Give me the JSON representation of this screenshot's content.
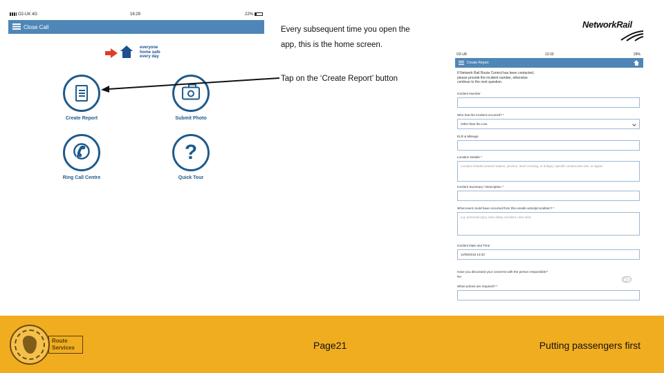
{
  "phone_left": {
    "status": {
      "carrier": "O2-UK 4G",
      "time": "16:29",
      "battery": "22%"
    },
    "title": "Close Call",
    "slogan": [
      "everyone",
      "home safe",
      "every day"
    ],
    "tiles": [
      {
        "label": "Create Report",
        "icon": "document-icon"
      },
      {
        "label": "Submit Photo",
        "icon": "camera-icon"
      },
      {
        "label": "Ring Call Centre",
        "icon": "phone-icon"
      },
      {
        "label": "Quick Tour",
        "icon": "question-icon"
      }
    ]
  },
  "instructions": {
    "home_line1": "Every subsequent time you open the",
    "home_line2": "app, this is the home screen.",
    "tap": "Tap on the ‘Create Report’ button"
  },
  "logo": {
    "name": "NetworkRail"
  },
  "phone_right": {
    "status": {
      "carrier": "O2-UK",
      "time": "13:33",
      "battery": "29%"
    },
    "title": "Create Report",
    "intro": [
      "If Network Rail Route Control has been contacted,",
      "please provide the incident number, otherwise",
      "continue to the next question."
    ],
    "fields": [
      {
        "label": "Incident Number",
        "value": ""
      },
      {
        "label": "Who has the incident occurred? *",
        "value": "Other than the Line"
      },
      {
        "label": "ELR & Mileage",
        "value": ""
      },
      {
        "label": "Location Details *",
        "value": "Location Details (nearest station, junction, level crossing, or bridge), specific construction site, or signal"
      },
      {
        "label": "Incident Summary / Description *",
        "value": ""
      },
      {
        "label": "What event could have occurred from this unsafe activity/condition? *",
        "value": "e.g. personal injury, train delay, accident, near miss"
      },
      {
        "label": "Incident Date and Time",
        "value": "11/06/2018 13:33"
      },
      {
        "label": "Have you discussed your concerns with the person responsible?",
        "value": "No"
      },
      {
        "label": "What actions are required? *",
        "value": ""
      }
    ]
  },
  "footer": {
    "logo_text": [
      "Route",
      "Services"
    ],
    "page": "Page21",
    "tagline": "Putting passengers first"
  },
  "colors": {
    "app_bar": "#4f86b7",
    "icon_blue": "#1d5a8c",
    "footer": "#f0ad20"
  }
}
